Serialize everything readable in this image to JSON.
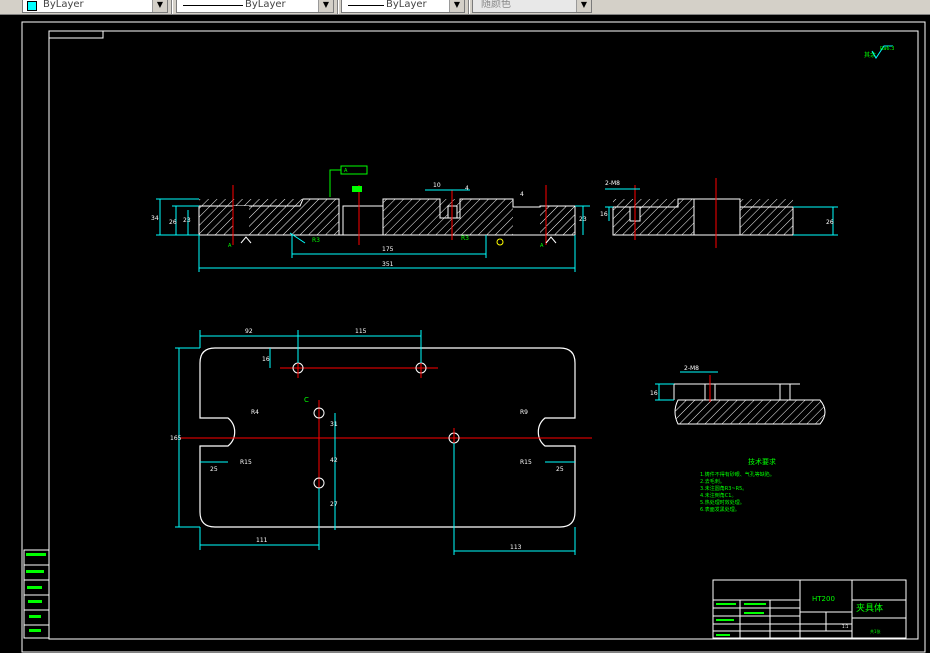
{
  "toolbar": {
    "color_value": "ByLayer",
    "linetype_value": "ByLayer",
    "lineweight_value": "ByLayer",
    "plotstyle_value": "随颜色"
  },
  "drawing": {
    "roughness_mark": "其余",
    "roughness_value": "Ra6.3",
    "section_note": "A",
    "top_dims": {
      "d1": "10",
      "d2": "4",
      "h1": "34",
      "h2": "26",
      "h3": "23",
      "r1": "R3",
      "r2": "R3",
      "len1": "175",
      "len2": "351"
    },
    "side_dims": {
      "holes": "2-M8",
      "h": "16",
      "h2": "26"
    },
    "plan_dims": {
      "a": "92",
      "b": "115",
      "c": "16",
      "r1": "R4",
      "r2": "R9",
      "r3": "R15",
      "r4": "R15",
      "w1": "25",
      "w2": "25",
      "h": "165",
      "d1": "31",
      "d2": "42",
      "d3": "27",
      "bottom1": "111",
      "bottom2": "113",
      "label_c": "C"
    },
    "detail_dims": {
      "holes": "2-M8",
      "h": "16"
    },
    "notes_title": "技术要求",
    "notes": [
      "1.铸件不得有砂眼、气孔等缺陷。",
      "2.去毛刺。",
      "3.未注圆角R3~R5。",
      "4.未注倒角C1。",
      "5.热处理时效处理。",
      "6.表面发黑处理。"
    ],
    "title_block": {
      "material": "HT200",
      "name": "夹具体",
      "scale": "1:1",
      "sheet": "共1张"
    }
  }
}
